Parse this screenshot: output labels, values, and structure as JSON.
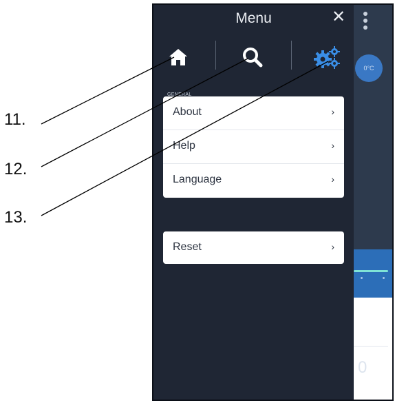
{
  "callouts": [
    "11.",
    "12.",
    "13."
  ],
  "menu": {
    "title": "Menu",
    "close_glyph": "✕",
    "icons": [
      "home-icon",
      "search-icon",
      "settings-gears-icon"
    ],
    "accent": "#3a8ee6",
    "section_label": "GENERAL",
    "items": [
      {
        "label": "About",
        "chevron": "›"
      },
      {
        "label": "Help",
        "chevron": "›"
      },
      {
        "label": "Language",
        "chevron": "›"
      }
    ],
    "reset": {
      "label": "Reset",
      "chevron": "›"
    }
  },
  "background_app": {
    "bubble_text": "0°C",
    "ghost_digit": "0"
  }
}
